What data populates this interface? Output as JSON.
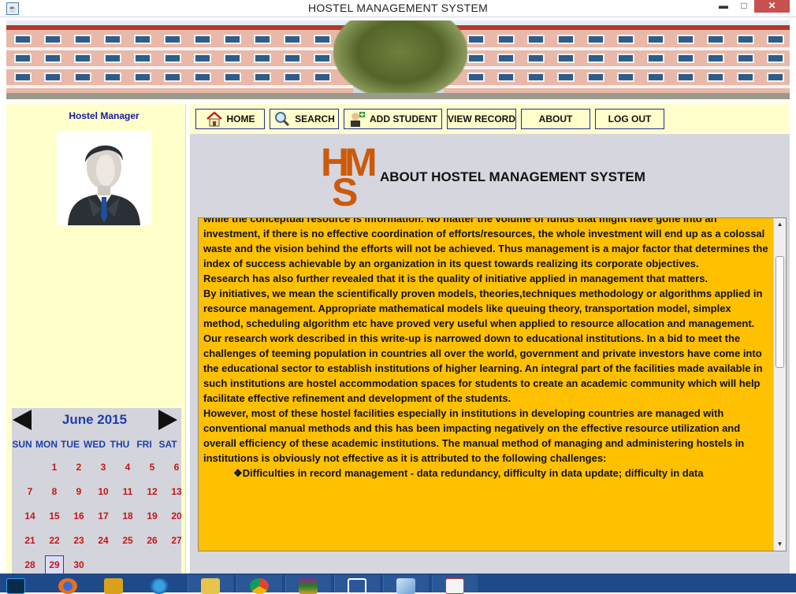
{
  "window": {
    "title": "HOSTEL MANAGEMENT SYSTEM",
    "min_glyph": "▬",
    "max_glyph": "□",
    "close_glyph": "✕"
  },
  "sidebar": {
    "manager_label": "Hostel Manager"
  },
  "calendar": {
    "month_label": "June 2015",
    "weekdays": [
      "SUN",
      "MON",
      "TUE",
      "WED",
      "THU",
      "FRI",
      "SAT"
    ],
    "weeks": [
      [
        "",
        "1",
        "2",
        "3",
        "4",
        "5",
        "6"
      ],
      [
        "7",
        "8",
        "9",
        "10",
        "11",
        "12",
        "13"
      ],
      [
        "14",
        "15",
        "16",
        "17",
        "18",
        "19",
        "20"
      ],
      [
        "21",
        "22",
        "23",
        "24",
        "25",
        "26",
        "27"
      ],
      [
        "28",
        "29",
        "30",
        "",
        "",
        "",
        ""
      ]
    ],
    "selected_day": "29"
  },
  "nav": {
    "home": "HOME",
    "search": "SEARCH",
    "add_student": "ADD STUDENT",
    "view_record": "VIEW RECORD",
    "about": "ABOUT",
    "logout": "LOG OUT"
  },
  "about": {
    "logo_letters": [
      "H",
      "M",
      "S"
    ],
    "title": "ABOUT HOSTEL MANAGEMENT SYSTEM",
    "paragraphs": [
      "while the conceptual resource is information. No matter the volume of funds that might have gone into an investment, if there is no effective coordination of efforts/resources, the whole investment will end up as a colossal waste and the vision behind the efforts will not be achieved. Thus management is a major factor that determines the index of success achievable by an organization in its quest towards realizing its corporate objectives.",
      "Research has also further revealed that it is the quality of initiative applied in management that matters.",
      "By initiatives, we mean the scientifically proven models, theories,techniques methodology or algorithms applied in resource management. Appropriate mathematical models like queuing theory, transportation model, simplex method, scheduling algorithm etc have proved very useful when applied to resource allocation and management.",
      "Our research work described in this write-up is narrowed down to educational institutions. In a bid to meet the challenges of teeming population in countries all over the world, government and private investors have come into the educational sector to establish institutions of higher learning. An integral part of the facilities made available in such institutions are hostel accommodation spaces for students to create an academic community which will help facilitate effective refinement and development of the students.",
      "However, most of these hostel facilities especially in institutions in developing countries are managed with conventional manual methods and this has been impacting negatively on the effective resource utilization and overall efficiency of these academic institutions. The manual method of managing and administering hostels in institutions is obviously not effective as it is attributed to the following challenges:"
    ],
    "bullet": "❖Difficulties in record management - data redundancy, difficulty in data update; difficulty in data"
  },
  "scroll": {
    "up_glyph": "▲",
    "down_glyph": "▼"
  },
  "colors": {
    "accent_blue": "#1e3fa8",
    "content_bg": "#ffc000",
    "panel_bg": "#ffffcc",
    "logo_orange": "#cc5a0c",
    "calendar_day_red": "#c01818"
  },
  "taskbar": {
    "items": [
      "photoshop-icon",
      "firefox-icon",
      "tools-icon",
      "network-icon",
      "folder-icon",
      "chrome-icon",
      "winrar-icon",
      "word-icon",
      "app-cube-icon",
      "java-icon"
    ]
  }
}
